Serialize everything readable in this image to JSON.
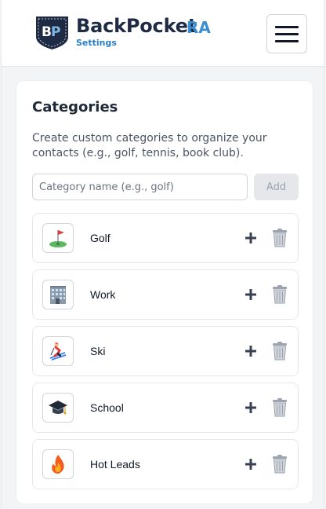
{
  "header": {
    "brand_name": "BackPocket",
    "brand_suffix": "RA",
    "brand_sub": "Settings",
    "logo_text": "BP",
    "menu_icon": "hamburger-menu-icon",
    "colors": {
      "brand_dark": "#1f2a44",
      "brand_accent": "#3b8fd0"
    }
  },
  "categories_card": {
    "title": "Categories",
    "description": "Create custom categories to organize your contacts (e.g., golf, tennis, book club).",
    "input_value": "",
    "input_placeholder": "Category name (e.g., golf)",
    "add_label": "Add"
  },
  "categories": [
    {
      "label": "Golf",
      "icon": "golf-flag-icon"
    },
    {
      "label": "Work",
      "icon": "office-building-icon"
    },
    {
      "label": "Ski",
      "icon": "skier-icon"
    },
    {
      "label": "School",
      "icon": "graduation-cap-icon"
    },
    {
      "label": "Hot Leads",
      "icon": "fire-icon"
    }
  ],
  "row_actions": {
    "add_icon": "plus-icon",
    "delete_icon": "trash-icon"
  }
}
